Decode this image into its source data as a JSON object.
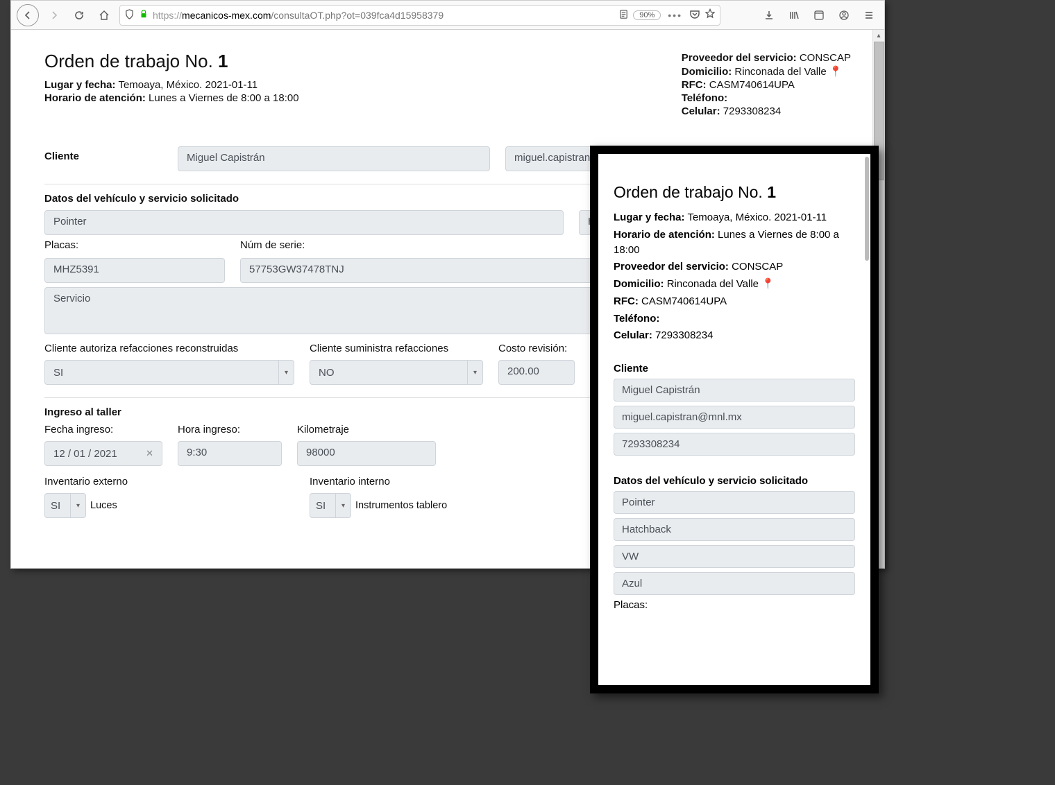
{
  "toolbar": {
    "url_prefix": "https://",
    "url_domain": "mecanicos-mex.com",
    "url_path": "/consultaOT.php?ot=039fca4d15958379",
    "zoom": "90%"
  },
  "workorder": {
    "title_prefix": "Orden de trabajo No. ",
    "number": "1",
    "place_date_label": "Lugar y fecha:",
    "place_date": "Temoaya, México. 2021-01-11",
    "hours_label": "Horario de atención:",
    "hours": "Lunes a Viernes de 8:00 a 18:00"
  },
  "provider": {
    "provider_label": "Proveedor del servicio:",
    "provider": "CONSCAP",
    "address_label": "Domicilio:",
    "address": "Rinconada del Valle",
    "rfc_label": "RFC:",
    "rfc": "CASM740614UPA",
    "phone_label": "Teléfono:",
    "phone": "",
    "cell_label": "Celular:",
    "cell": "7293308234"
  },
  "client": {
    "section_label": "Cliente",
    "name": "Miguel Capistrán",
    "email": "miguel.capistran@mnl.mx",
    "phone": "7293308234"
  },
  "vehicle": {
    "section_label": "Datos del vehículo y servicio solicitado",
    "model": "Pointer",
    "body": "Hatchback",
    "make": "VW",
    "color": "Azul",
    "plates_label": "Placas:",
    "plates": "MHZ5391",
    "serial_label": "Núm de serie:",
    "serial": "57753GW37478TNJ",
    "service": "Servicio",
    "auth_rebuild_label": "Cliente autoriza refacciones reconstruidas",
    "auth_rebuild": "SI",
    "client_supplies_label": "Cliente suministra refacciones",
    "client_supplies": "NO",
    "review_cost_label": "Costo revisión:",
    "review_cost": "200.00"
  },
  "intake": {
    "section_label": "Ingreso al taller",
    "date_label": "Fecha ingreso:",
    "date": "12 / 01 / 2021",
    "time_label": "Hora ingreso:",
    "time": "9:30",
    "km_label": "Kilometraje",
    "km": "98000",
    "ext_inv_label": "Inventario externo",
    "ext_inv_value": "SI",
    "ext_inv_item": "Luces",
    "int_inv_label": "Inventario interno",
    "int_inv_value": "SI",
    "int_inv_item": "Instrumentos tablero"
  }
}
